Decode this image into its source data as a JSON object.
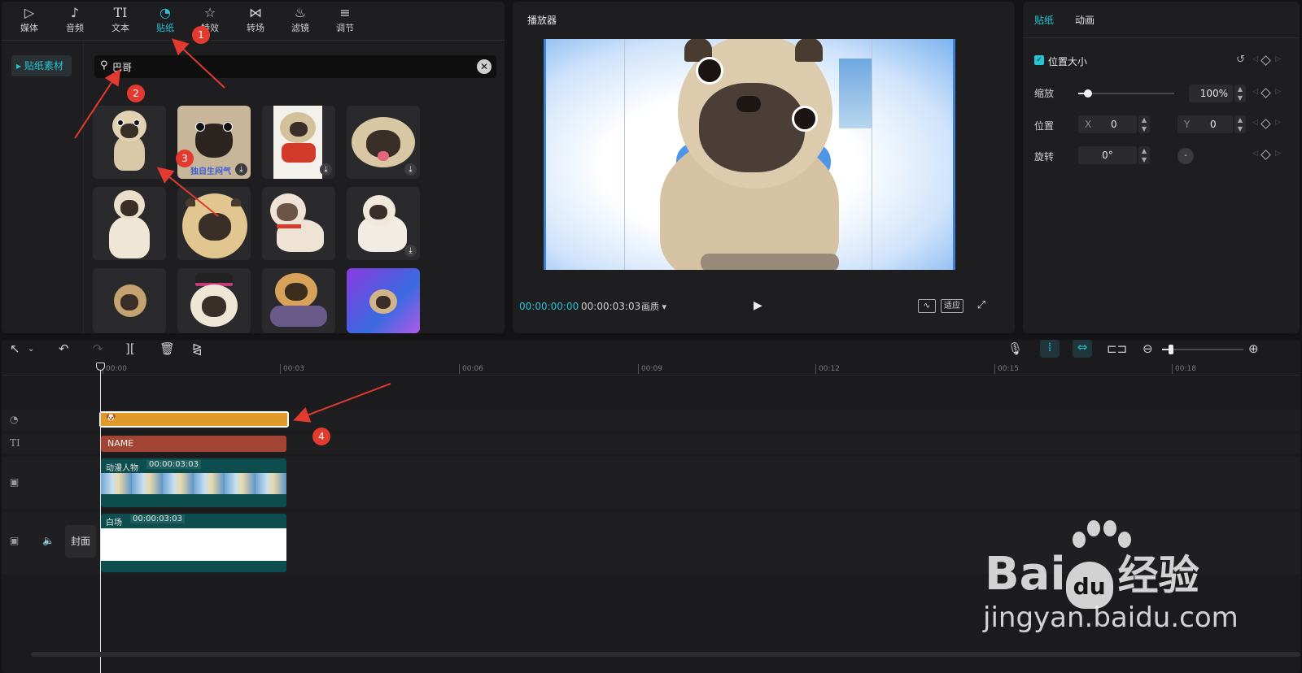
{
  "toolbar": {
    "tools": [
      {
        "label": "媒体",
        "icon": "media-icon"
      },
      {
        "label": "音频",
        "icon": "audio-icon"
      },
      {
        "label": "文本",
        "icon": "text-icon"
      },
      {
        "label": "贴纸",
        "icon": "sticker-icon"
      },
      {
        "label": "特效",
        "icon": "effects-icon"
      },
      {
        "label": "转场",
        "icon": "transition-icon"
      },
      {
        "label": "滤镜",
        "icon": "filter-icon"
      },
      {
        "label": "调节",
        "icon": "adjust-icon"
      }
    ],
    "active": "贴纸"
  },
  "sidebar": {
    "category": "贴纸素材"
  },
  "search": {
    "value": "巴哥",
    "icon": "search-icon"
  },
  "stickers": {
    "thumb_2_caption": "独自生闷气"
  },
  "player": {
    "title": "播放器",
    "current_time": "00:00:00:00",
    "total_time": "00:00:03:03",
    "quality": "画质",
    "fit": "适应"
  },
  "props": {
    "tabs": [
      "贴纸",
      "动画"
    ],
    "section": "位置大小",
    "scale_label": "缩放",
    "scale_value": "100%",
    "scale_level": 0.1,
    "position_label": "位置",
    "x_label": "X",
    "x_value": "0",
    "y_label": "Y",
    "y_value": "0",
    "rotate_label": "旋转",
    "rotate_value": "0°"
  },
  "timeline": {
    "ruler": [
      "00:00",
      "00:03",
      "00:06",
      "00:09",
      "00:12",
      "00:15",
      "00:18"
    ],
    "text_clip": "NAME",
    "video_clip": {
      "name": "动漫人物",
      "duration": "00:00:03:03"
    },
    "main_clip": {
      "name": "白场",
      "duration": "00:00:03:03"
    },
    "cover": "封面"
  },
  "annotations": [
    "1",
    "2",
    "3",
    "4"
  ],
  "colors": {
    "accent": "#22c4d6",
    "sticker_clip": "#e09a2a",
    "text_clip": "#a24434",
    "video_clip": "#0d4d4d",
    "marker": "#e23a2e"
  },
  "watermark": {
    "brand1": "Bai",
    "brand2": "du",
    "brand3": "经验",
    "url": "jingyan.baidu.com"
  }
}
